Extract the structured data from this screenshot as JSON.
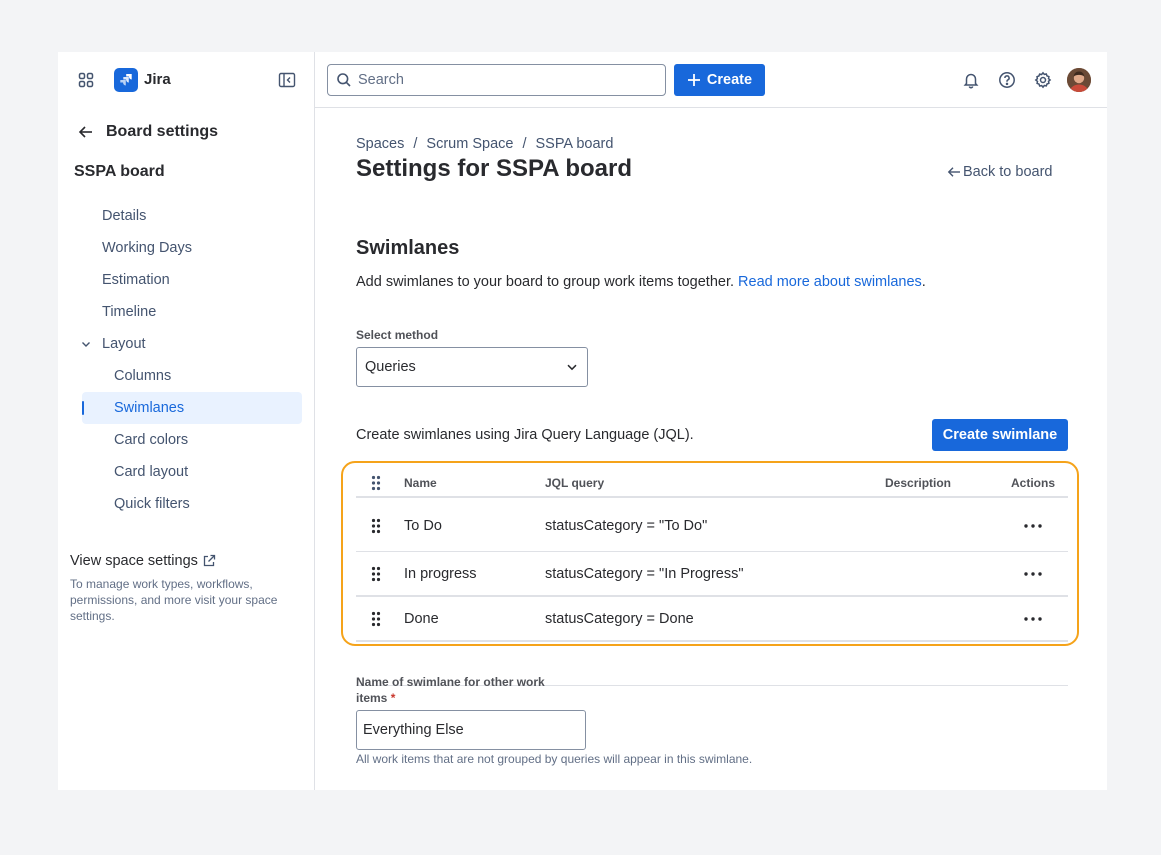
{
  "sidebar": {
    "brand": "Jira",
    "back_title": "Board settings",
    "board_name": "SSPA board",
    "nav": {
      "details": "Details",
      "working_days": "Working Days",
      "estimation": "Estimation",
      "timeline": "Timeline",
      "layout": "Layout",
      "columns": "Columns",
      "swimlanes": "Swimlanes",
      "card_colors": "Card colors",
      "card_layout": "Card layout",
      "quick_filters": "Quick filters"
    },
    "selected": "Swimlanes",
    "view_space_settings": "View space settings",
    "view_space_desc": "To manage work types, workflows, permissions, and more visit your space settings."
  },
  "topbar": {
    "search_placeholder": "Search",
    "create_label": "Create"
  },
  "breadcrumbs": {
    "spaces": "Spaces",
    "scrum_space": "Scrum Space",
    "board": "SSPA board",
    "separator": "/"
  },
  "page_title": "Settings for SSPA board",
  "back_to_board": "Back to board",
  "swimlanes": {
    "title": "Swimlanes",
    "description": "Add swimlanes to your board to group work items together.",
    "read_more": "Read more about swimlanes",
    "select_method_label": "Select method",
    "select_method_value": "Queries",
    "jql_intro": "Create swimlanes using Jira Query Language (JQL).",
    "create_button": "Create swimlane",
    "table": {
      "headers": {
        "name": "Name",
        "jql": "JQL query",
        "description": "Description",
        "actions": "Actions"
      },
      "rows": [
        {
          "name": "To Do",
          "jql": "statusCategory = \"To Do\"",
          "description": ""
        },
        {
          "name": "In progress",
          "jql": "statusCategory = \"In Progress\"",
          "description": ""
        },
        {
          "name": "Done",
          "jql": "statusCategory = Done",
          "description": ""
        }
      ]
    },
    "other_label_line1": "Name of swimlane for other work",
    "other_label_line2": "items",
    "required_mark": "*",
    "other_value": "Everything Else",
    "other_helper": "All work items that are not grouped by queries will appear in this swimlane."
  },
  "colors": {
    "brand_blue": "#1868db",
    "highlight_orange": "#f5a31a"
  },
  "icons": [
    "app-switcher-icon",
    "jira-logo-icon",
    "collapse-sidebar-icon",
    "arrow-left-icon",
    "chevron-down-icon",
    "external-link-icon",
    "search-icon",
    "plus-icon",
    "bell-icon",
    "help-icon",
    "gear-icon",
    "drag-handle-icon",
    "more-icon"
  ]
}
